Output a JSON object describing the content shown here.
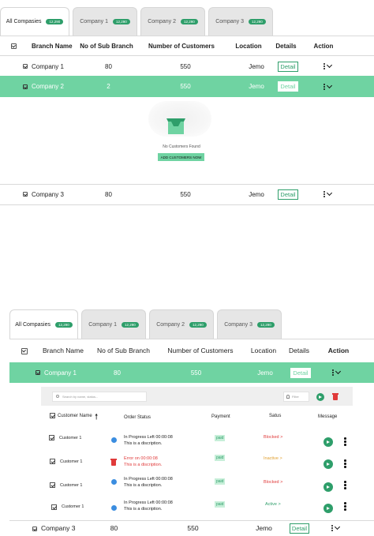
{
  "top": {
    "tabs": [
      {
        "label": "All Compasies",
        "badge": "12,290"
      },
      {
        "label": "Company 1",
        "badge": "12,290"
      },
      {
        "label": "Company 2",
        "badge": "12,290"
      },
      {
        "label": "Company 3",
        "badge": "12,290"
      }
    ],
    "headers": [
      "Branch Name",
      "No of Sub Branch",
      "Number of Customers",
      "Location",
      "Details",
      "Action"
    ],
    "rows": [
      {
        "name": "Company 1",
        "sub": "80",
        "customers": "550",
        "location": "Jemo",
        "detail": "Detail"
      },
      {
        "name": "Company 2",
        "sub": "2",
        "customers": "550",
        "location": "Jemo",
        "detail": "Detail"
      },
      {
        "name": "Company 3",
        "sub": "80",
        "customers": "550",
        "location": "Jemo",
        "detail": "Detail"
      }
    ],
    "empty": {
      "text": "No Customers Found",
      "button": "ADD CUSTOMERS NOW"
    }
  },
  "bottom": {
    "tabs": [
      {
        "label": "All Compasies",
        "badge": "12,290"
      },
      {
        "label": "Company 1",
        "badge": "12,290"
      },
      {
        "label": "Company 2",
        "badge": "12,290"
      },
      {
        "label": "Company 3",
        "badge": "12,290"
      }
    ],
    "headers": [
      "Branch Name",
      "No of Sub Branch",
      "Number of Customers",
      "Location",
      "Details",
      "Action"
    ],
    "rows": [
      {
        "name": "Company 1",
        "sub": "80",
        "customers": "550",
        "location": "Jemo",
        "detail": "Detail"
      },
      {
        "name": "Company 3",
        "sub": "80",
        "customers": "550",
        "location": "Jemo",
        "detail": "Detail"
      }
    ],
    "sub_table": {
      "search_placeholder": "Search by name, status...",
      "filter_label": "Filter",
      "headers": {
        "name": "Customer Name",
        "status": "Order Status",
        "payment": "Payment",
        "state": "Satus",
        "message": "Message"
      },
      "rows": [
        {
          "name": "Customer 1",
          "status_line": "In Progress Left 00:00:08",
          "desc": "This is a discription.",
          "payment": "paid",
          "state": "Blocked >",
          "state_color": "#e03a3a",
          "icon": "dot"
        },
        {
          "name": "Customer 1",
          "status_line": "Error  on  00:00:08",
          "desc": "This is a discription.",
          "payment": "paid",
          "state": "Inactive >",
          "state_color": "#e0a030",
          "icon": "trash",
          "error": true
        },
        {
          "name": "Customer 1",
          "status_line": "In Progress Left 00:00:08",
          "desc": "This is a discription.",
          "payment": "paid",
          "state": "Blocked >",
          "state_color": "#e03a3a",
          "icon": "dot"
        },
        {
          "name": "Customer 1",
          "status_line": "In Progress Left 00:00:08",
          "desc": "This is a discription.",
          "payment": "paid",
          "state": "Active >",
          "state_color": "#2e9e6a",
          "icon": "dot"
        }
      ]
    }
  },
  "colors": {
    "green": "#6fd3a2",
    "accent": "#2e9e6a",
    "red": "#e03a3a"
  }
}
